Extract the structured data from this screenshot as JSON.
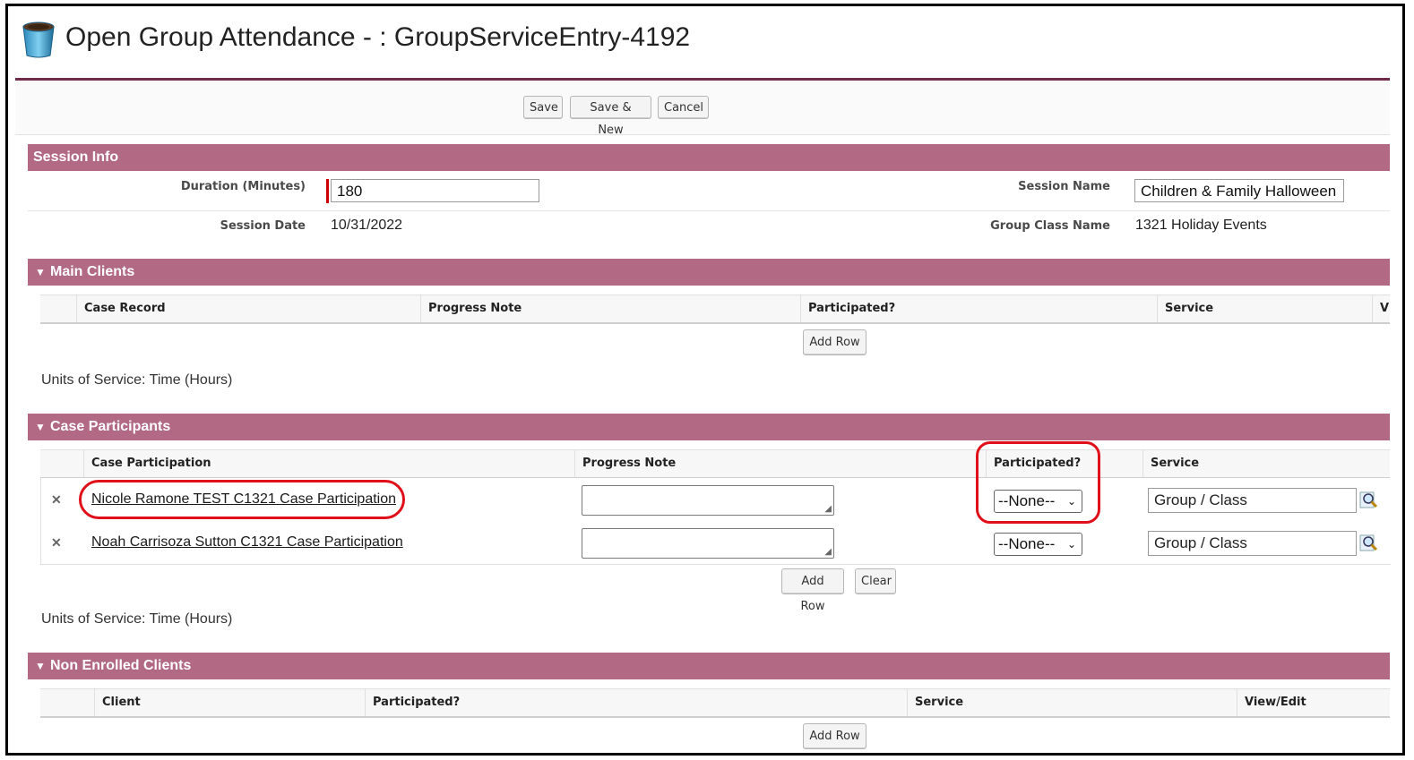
{
  "window": {
    "title": "Open Group Attendance - : GroupServiceEntry-4192"
  },
  "toolbar": {
    "save": "Save",
    "save_new": "Save & New",
    "cancel": "Cancel"
  },
  "session_info": {
    "heading": "Session Info",
    "duration_label": "Duration (Minutes)",
    "duration_value": "180",
    "session_name_label": "Session Name",
    "session_name_value": "Children & Family Halloween",
    "session_date_label": "Session Date",
    "session_date_value": "10/31/2022",
    "group_class_label": "Group Class Name",
    "group_class_value": "1321 Holiday Events"
  },
  "main_clients": {
    "heading": "Main Clients",
    "columns": [
      "Case Record",
      "Progress Note",
      "Participated?",
      "Service",
      "V"
    ],
    "add_row": "Add Row",
    "units": "Units of Service: Time (Hours)"
  },
  "case_participants": {
    "heading": "Case Participants",
    "columns": [
      "Case Participation",
      "Progress Note",
      "Participated?",
      "Service"
    ],
    "rows": [
      {
        "name": "Nicole Ramone TEST C1321 Case Participation",
        "participated": "--None--",
        "service": "Group / Class"
      },
      {
        "name": "Noah Carrisoza Sutton C1321 Case Participation",
        "participated": "--None--",
        "service": "Group / Class"
      }
    ],
    "add_row": "Add Row",
    "clear": "Clear",
    "units": "Units of Service: Time (Hours)"
  },
  "non_enrolled": {
    "heading": "Non Enrolled Clients",
    "columns": [
      "Client",
      "Participated?",
      "Service",
      "View/Edit"
    ],
    "add_row": "Add Row"
  },
  "colors": {
    "section_bar": "#b26984",
    "header_rule": "#6f2b4a",
    "highlight": "#e0101a"
  },
  "icons": {
    "app": "coffee-cup-icon",
    "collapse": "triangle-down-icon",
    "delete": "close-x-icon",
    "lookup": "magnifier-icon"
  }
}
